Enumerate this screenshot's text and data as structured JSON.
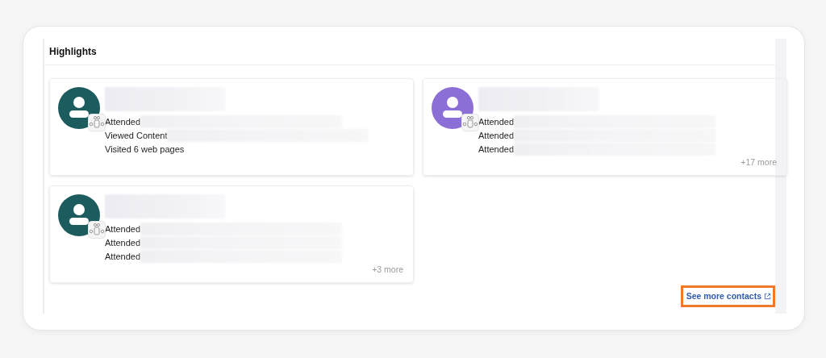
{
  "section": {
    "title": "Highlights"
  },
  "contacts": [
    {
      "color": "#1d5c5e",
      "activities": [
        {
          "label": "Attended",
          "redacted": true
        },
        {
          "label": "Viewed Content",
          "redacted": true
        },
        {
          "label": "Visited 6 web pages",
          "redacted": false
        }
      ]
    },
    {
      "color": "#8c6fd6",
      "activities": [
        {
          "label": "Attended",
          "redacted": true
        },
        {
          "label": "Attended",
          "redacted": true
        },
        {
          "label": "Attended",
          "redacted": true
        }
      ],
      "more": "+17 more"
    },
    {
      "color": "#1d5c5e",
      "activities": [
        {
          "label": "Attended",
          "redacted": true
        },
        {
          "label": "Attended",
          "redacted": true
        },
        {
          "label": "Attended",
          "redacted": true
        }
      ],
      "more": "+3 more"
    }
  ],
  "link": {
    "label": "See more contacts",
    "highlighted": true
  }
}
